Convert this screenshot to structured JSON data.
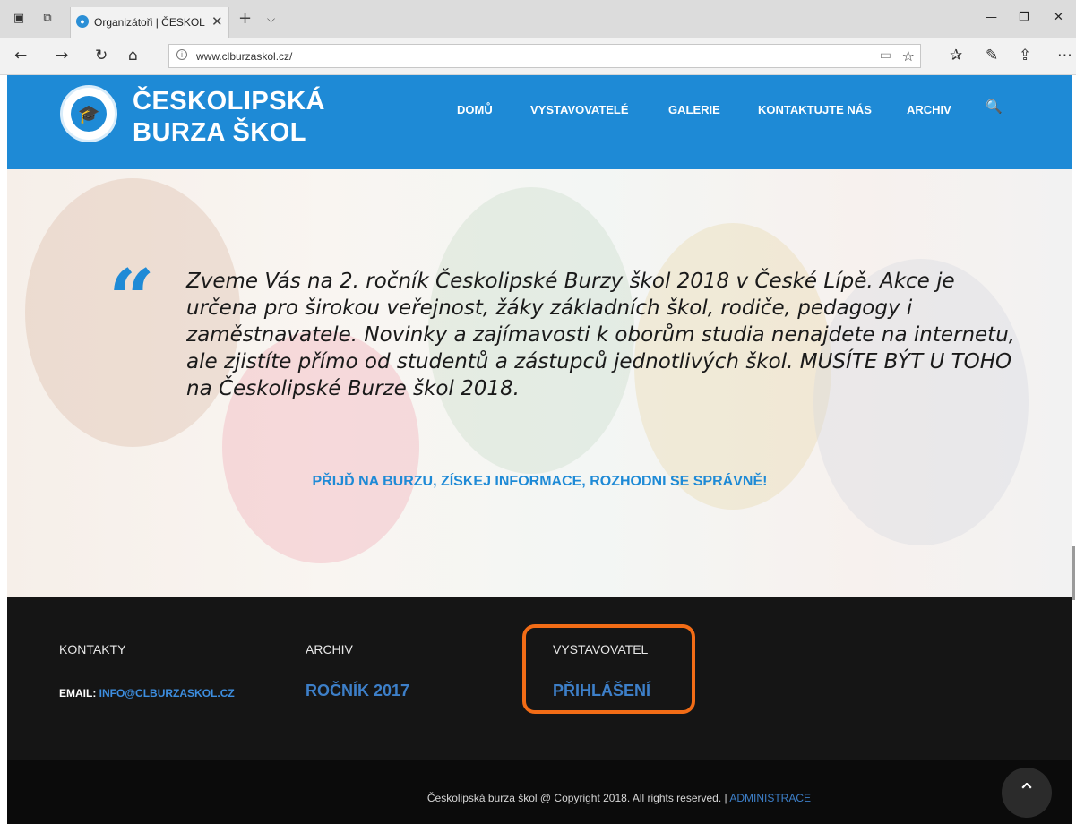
{
  "browser": {
    "tab_title": "Organizátoři | ČESKOLIF",
    "url": "www.clburzaskol.cz/",
    "new_tab_glyph": "+",
    "icons": [
      "tab-preview-icon",
      "set-aside-tabs-icon",
      "favicon-icon",
      "close-tab-icon",
      "back-icon",
      "forward-icon",
      "refresh-icon",
      "home-icon",
      "info-icon",
      "reading-view-icon",
      "favorite-star-icon",
      "favorites-hub-icon",
      "pen-icon",
      "share-icon",
      "more-icon",
      "minimize-icon",
      "restore-icon",
      "close-window-icon"
    ]
  },
  "site": {
    "brand_line1": "ČESKOLIPSKÁ",
    "brand_line2": "BURZA ŠKOL",
    "menu": [
      "DOMŮ",
      "VYSTAVOVATELÉ",
      "GALERIE",
      "KONTAKTUJTE NÁS",
      "ARCHIV"
    ],
    "accent_color": "#1e8ad6"
  },
  "hero": {
    "quote": "Zveme Vás na 2. ročník Českolipské Burzy škol 2018 v České Lípě. Akce je určena pro širokou veřejnost, žáky základních škol, rodiče, pedagogy i zaměstnavatele. Novinky a zajímavosti k oborům studia nenajdete na internetu, ale zjistíte přímo od studentů a zástupců jednotlivých škol. MUSÍTE BÝT U TOHO na Českolipské Burze škol 2018.",
    "slogan": "PŘIJĎ NA BURZU, ZÍSKEJ INFORMACE, ROZHODNI SE SPRÁVNĚ!"
  },
  "footer": {
    "contacts_heading": "KONTAKTY",
    "email_label": "EMAIL:",
    "email_value": "INFO@CLBURZASKOL.CZ",
    "archive_heading": "ARCHIV",
    "archive_link": "ROČNÍK 2017",
    "exhibitor_heading": "VYSTAVOVATEL",
    "exhibitor_link": "PŘIHLÁŠENÍ",
    "copyright": "Českolipská burza škol @ Copyright 2018. All rights reserved. |",
    "admin_link": "ADMINISTRACE",
    "highlight_color": "#f26c16"
  }
}
